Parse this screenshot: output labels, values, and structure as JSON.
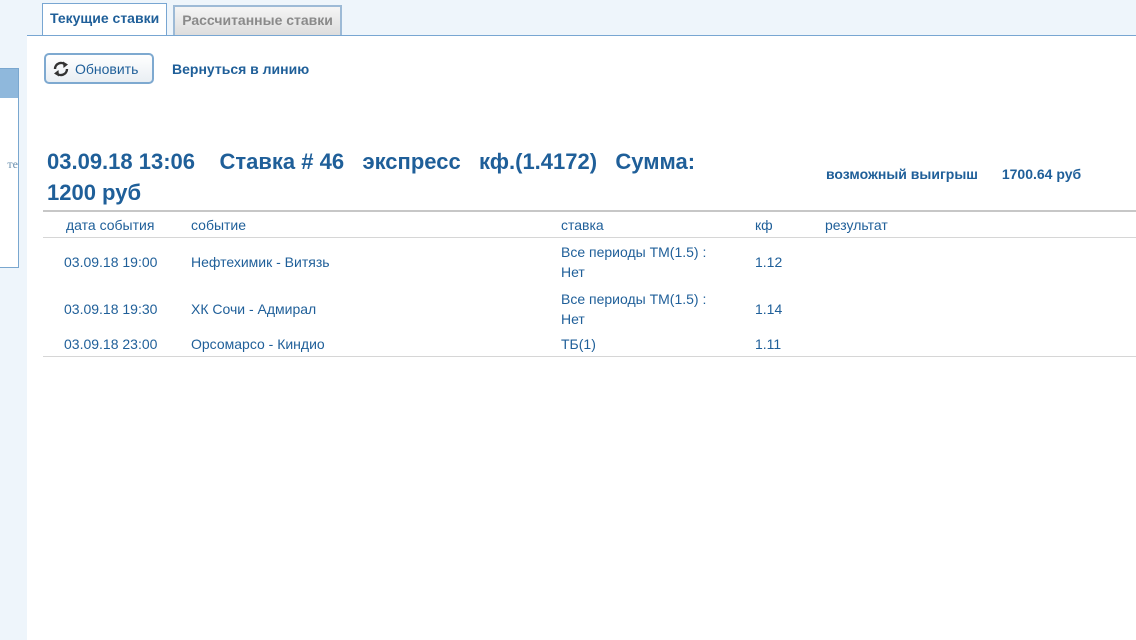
{
  "left_stub": {
    "text": "те"
  },
  "tabs": [
    {
      "label": "Текущие ставки",
      "active": true
    },
    {
      "label": "Рассчитанные ставки",
      "active": false
    }
  ],
  "toolbar": {
    "refresh_label": "Обновить",
    "back_label": "Вернуться в линию"
  },
  "bet": {
    "datetime": "03.09.18 13:06",
    "number": "Ставка # 46",
    "type": "экспресс",
    "coef": "кф.(1.4172)",
    "sum_label": "Сумма:",
    "sum_value": "1200 руб",
    "possible_win_label": "возможный выигрыш",
    "possible_win_value": "1700.64 руб"
  },
  "table": {
    "headers": [
      "дата события",
      "событие",
      "ставка",
      "кф",
      "результат"
    ],
    "rows": [
      {
        "date": "03.09.18 19:00",
        "event": "Нефтехимик - Витязь",
        "bet_line1": "Все периоды ТМ(1.5) :",
        "bet_line2": "Нет",
        "kf": "1.12",
        "result": ""
      },
      {
        "date": "03.09.18 19:30",
        "event": "ХК Сочи - Адмирал",
        "bet_line1": "Все периоды ТМ(1.5) :",
        "bet_line2": "Нет",
        "kf": "1.14",
        "result": ""
      },
      {
        "date": "03.09.18 23:00",
        "event": "Орсомарсо - Киндио",
        "bet_line1": "ТБ(1)",
        "bet_line2": "",
        "kf": "1.11",
        "result": ""
      }
    ]
  },
  "colors": {
    "accent": "#1f5f99",
    "border": "#78a6d2",
    "background": "#eef5fb"
  }
}
